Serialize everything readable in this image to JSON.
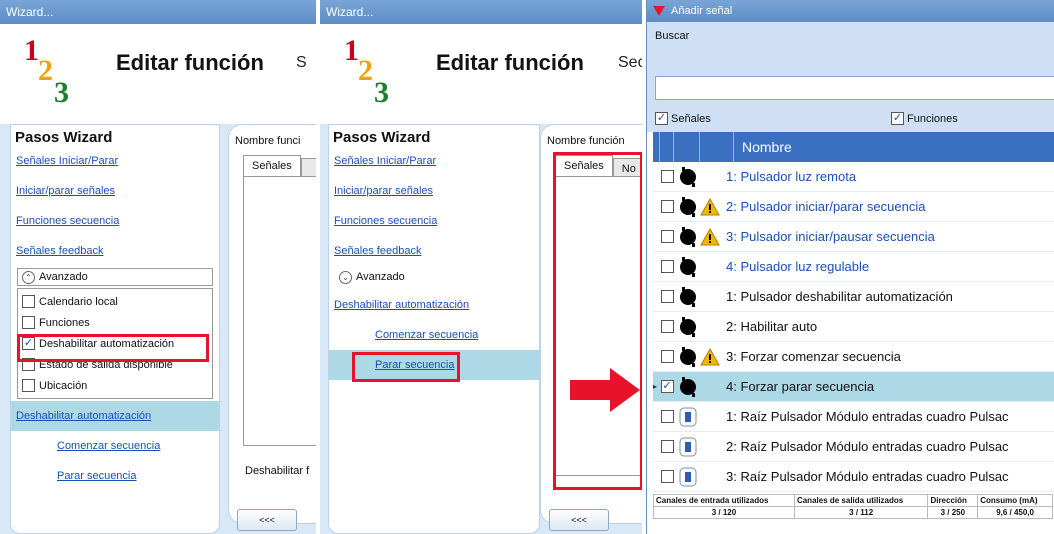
{
  "window1": {
    "title": "Wizard...",
    "heading": "Editar función",
    "heading_cut": "S",
    "logo_digits": [
      "1",
      "2",
      "3"
    ],
    "steps_title": "Pasos Wizard",
    "links": [
      "Señales Iniciar/Parar",
      "Iniciar/parar señales",
      "Funciones secuencia",
      "Señales feedback"
    ],
    "advanced_label": "Avanzado",
    "checkboxes": [
      {
        "label": "Calendario local",
        "checked": false
      },
      {
        "label": "Funciones",
        "checked": false
      },
      {
        "label": "Deshabilitar automatización",
        "checked": true
      },
      {
        "label": "Estado de salida disponible",
        "checked": false
      },
      {
        "label": "Ubicación",
        "checked": false
      }
    ],
    "sub_links": [
      "Deshabilitar automatización",
      "Comenzar secuencia",
      "Parar secuencia"
    ],
    "right_label": "Nombre funci",
    "tab_label": "Señales",
    "footer_text": "Deshabilitar f",
    "back_button": "<<<"
  },
  "window2": {
    "title": "Wizard...",
    "heading": "Editar función",
    "heading_cut": "Sec",
    "steps_title": "Pasos Wizard",
    "links": [
      "Señales Iniciar/Parar",
      "Iniciar/parar señales",
      "Funciones secuencia",
      "Señales feedback"
    ],
    "advanced_label": "Avanzado",
    "sub_links": [
      "Deshabilitar automatización",
      "Comenzar secuencia",
      "Parar secuencia"
    ],
    "right_label": "Nombre función",
    "tab_label": "Señales",
    "tab2_label": "No",
    "back_button": "<<<"
  },
  "window3": {
    "title": "Añadir señal",
    "search_label": "Buscar",
    "search_value": "",
    "filter_signals": "Señales",
    "filter_functions": "Funciones",
    "column_name": "Nombre",
    "rows": [
      {
        "name": "1: Pulsador luz remota",
        "blue": true,
        "warn": false,
        "checked": false,
        "icon": "pushbutton-icon",
        "sel": false
      },
      {
        "name": "2: Pulsador iniciar/parar secuencia",
        "blue": true,
        "warn": true,
        "checked": false,
        "icon": "pushbutton-icon",
        "sel": false
      },
      {
        "name": "3: Pulsador iniciar/pausar secuencia",
        "blue": true,
        "warn": true,
        "checked": false,
        "icon": "pushbutton-icon",
        "sel": false
      },
      {
        "name": "4: Pulsador luz regulable",
        "blue": true,
        "warn": false,
        "checked": false,
        "icon": "pushbutton-icon",
        "sel": false
      },
      {
        "name": "1: Pulsador deshabilitar automatización",
        "blue": false,
        "warn": false,
        "checked": false,
        "icon": "pushbutton-icon",
        "sel": false
      },
      {
        "name": "2: Habilitar auto",
        "blue": false,
        "warn": false,
        "checked": false,
        "icon": "pushbutton-icon",
        "sel": false
      },
      {
        "name": "3: Forzar comenzar secuencia",
        "blue": false,
        "warn": true,
        "checked": false,
        "icon": "pushbutton-icon",
        "sel": false
      },
      {
        "name": "4: Forzar parar secuencia",
        "blue": false,
        "warn": false,
        "checked": true,
        "icon": "pushbutton-icon",
        "sel": true
      },
      {
        "name": "1: Raíz Pulsador Módulo entradas cuadro Pulsac",
        "blue": false,
        "warn": false,
        "checked": false,
        "icon": "module-icon",
        "sel": false
      },
      {
        "name": "2: Raíz Pulsador Módulo entradas cuadro Pulsac",
        "blue": false,
        "warn": false,
        "checked": false,
        "icon": "module-icon",
        "sel": false
      },
      {
        "name": "3: Raíz Pulsador Módulo entradas cuadro Pulsac",
        "blue": false,
        "warn": false,
        "checked": false,
        "icon": "module-icon",
        "sel": false
      }
    ],
    "stats_headers": [
      "Canales de entrada utilizados",
      "Canales de salida utilizados",
      "Dirección",
      "Consumo (mA)"
    ],
    "stats_values": [
      "3 / 120",
      "3 / 112",
      "3 / 250",
      "9,6 / 450,0"
    ]
  },
  "colors": {
    "highlight_red": "#e8132a",
    "link_blue": "#1a4fb3",
    "selected_row": "#add8e6",
    "header_blue": "#3b6fc0"
  }
}
